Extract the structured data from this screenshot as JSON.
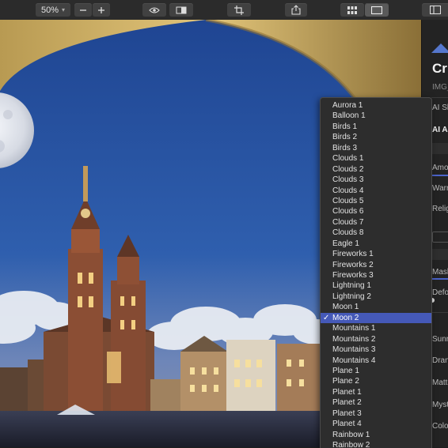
{
  "toolbar": {
    "zoom_value": "50%",
    "icons": [
      "minus-icon",
      "plus-icon",
      "eye-icon",
      "compare-icon",
      "crop-icon",
      "share-icon",
      "grid-icon",
      "single-view-icon",
      "sidebar-icon"
    ]
  },
  "panel": {
    "title": "Cr",
    "subtitle": "IMG_",
    "labels": [
      "AI Sk",
      "AI A",
      "Amou",
      "Warm",
      "Relig",
      "Mask",
      "Defoc",
      "Sunr",
      "Dran",
      "Matt",
      "Myst",
      "Colo"
    ]
  },
  "dropdown": {
    "selected": "Moon 2",
    "options": [
      "Aurora 1",
      "Balloon 1",
      "Birds 1",
      "Birds 2",
      "Birds 3",
      "Clouds 1",
      "Clouds 2",
      "Clouds 3",
      "Clouds 4",
      "Clouds 5",
      "Clouds 6",
      "Clouds 7",
      "Clouds 8",
      "Eagle 1",
      "Fireworks 1",
      "Fireworks 2",
      "Fireworks 3",
      "Lightning 1",
      "Lightning 2",
      "Moon 1",
      "Moon 2",
      "Mountains 1",
      "Mountains 2",
      "Mountains 3",
      "Mountains 4",
      "Plane 1",
      "Plane 2",
      "Planet 1",
      "Planet 2",
      "Planet 3",
      "Planet 4",
      "Rainbow 1",
      "Rainbow 2"
    ]
  },
  "colors": {
    "accent": "#4559b8",
    "sky": "#2a4f99",
    "arch": "#d6b76a"
  }
}
